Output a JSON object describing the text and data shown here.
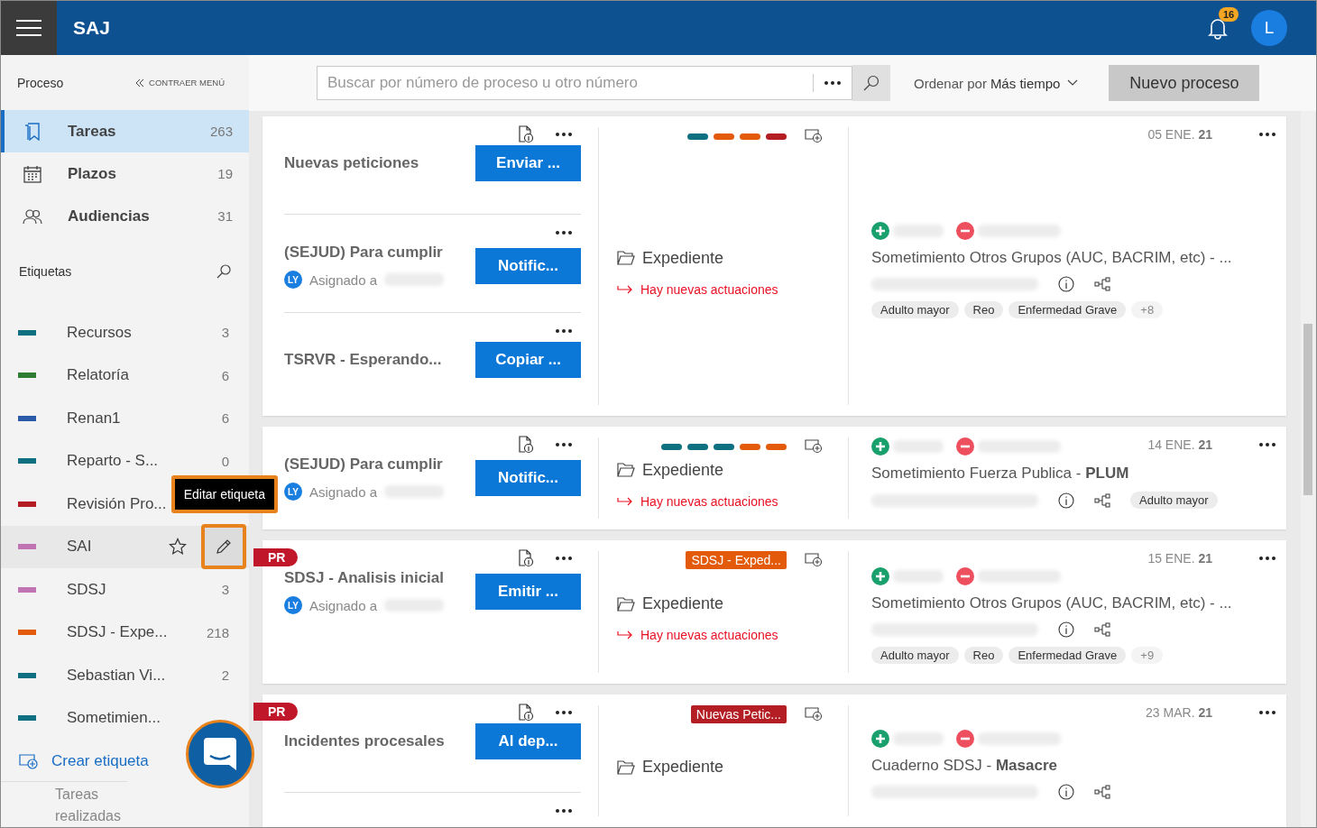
{
  "header": {
    "title": "SAJ",
    "notifications": "16",
    "avatar": "L"
  },
  "sidebar": {
    "section": "Proceso",
    "collapse": "CONTRAER MENÚ",
    "nav": [
      {
        "label": "Tareas",
        "count": "263",
        "selected": true
      },
      {
        "label": "Plazos",
        "count": "19",
        "selected": false
      },
      {
        "label": "Audiencias",
        "count": "31",
        "selected": false
      }
    ],
    "labels_title": "Etiquetas",
    "labels": [
      {
        "name": "Recursos",
        "count": "3",
        "color": "#0e7080",
        "hovered": false
      },
      {
        "name": "Relatoría",
        "count": "6",
        "color": "#2e7d32",
        "hovered": false
      },
      {
        "name": "Renan1",
        "count": "6",
        "color": "#2a5aa8",
        "hovered": false
      },
      {
        "name": "Reparto - S...",
        "count": "0",
        "color": "#0e7080",
        "hovered": false
      },
      {
        "name": "Revisión Pro...",
        "color": "#b41d23",
        "hovered": false
      },
      {
        "name": "SAI",
        "color": "#c074b4",
        "hovered": true
      },
      {
        "name": "SDSJ",
        "count": "3",
        "color": "#c074b4",
        "hovered": false
      },
      {
        "name": "SDSJ - Expe...",
        "count": "218",
        "color": "#e35a0b",
        "hovered": false
      },
      {
        "name": "Sebastian Vi...",
        "count": "2",
        "color": "#0e7080",
        "hovered": false
      },
      {
        "name": "Sometimien...",
        "color": "#0e7080",
        "hovered": false
      }
    ],
    "tooltip": "Editar etiqueta",
    "create": "Crear etiqueta",
    "done": "Tareas realizadas"
  },
  "toolbar": {
    "placeholder": "Buscar por número de proceso u otro número",
    "sort_label": "Ordenar por",
    "sort_value": "Más tiempo",
    "new_button": "Nuevo proceso"
  },
  "cards": [
    {
      "tasks": [
        {
          "title": "Nuevas peticiones",
          "button": "Enviar ...",
          "doc": true
        },
        {
          "title": "(SEJUD) Para cumplir",
          "button": "Notific...",
          "doc": false,
          "assigned": {
            "initials": "LY",
            "text": "Asignado a"
          }
        },
        {
          "title": "TSRVR - Esperando...",
          "button": "Copiar ...",
          "doc": false
        }
      ],
      "middle": {
        "markers": [
          {
            "color": "#0e7080"
          },
          {
            "color": "#e35a0b"
          },
          {
            "color": "#e35a0b"
          },
          {
            "color": "#b41d23"
          }
        ],
        "folder": "Expediente",
        "news": "Hay nuevas actuaciones"
      },
      "right": {
        "date": "05 ENE.",
        "year": "21",
        "title": "Sometimiento Otros Grupos (AUC, BACRIM, etc) - ...",
        "chips": [
          "Adulto mayor",
          "Reo",
          "Enfermedad Grave"
        ],
        "more": "+8",
        "chips_inline": false
      }
    },
    {
      "tasks": [
        {
          "title": "(SEJUD) Para cumplir",
          "button": "Notific...",
          "doc": true,
          "assigned": {
            "initials": "LY",
            "text": "Asignado a"
          }
        }
      ],
      "middle": {
        "markers": [
          {
            "color": "#0e7080"
          },
          {
            "color": "#0e7080"
          },
          {
            "color": "#0e7080"
          },
          {
            "color": "#e35a0b"
          },
          {
            "color": "#e35a0b"
          }
        ],
        "folder": "Expediente",
        "news": "Hay nuevas actuaciones"
      },
      "right": {
        "date": "14 ENE.",
        "year": "21",
        "title": "Sometimiento Fuerza Publica - **PLUM**",
        "chips": [
          "Adulto mayor"
        ],
        "chips_inline": true
      }
    },
    {
      "badge": "PR",
      "tasks": [
        {
          "title": "SDSJ - Analisis inicial",
          "button": "Emitir ...",
          "doc": true,
          "assigned": {
            "initials": "LY",
            "text": "Asignado a"
          }
        }
      ],
      "middle": {
        "label": {
          "text": "SDSJ - Exped...",
          "color": "#e35a0b"
        },
        "folder": "Expediente",
        "news": "Hay nuevas actuaciones"
      },
      "right": {
        "date": "15 ENE.",
        "year": "21",
        "title": "Sometimiento Otros Grupos (AUC, BACRIM, etc) - ...",
        "chips": [
          "Adulto mayor",
          "Reo",
          "Enfermedad Grave"
        ],
        "more": "+9",
        "chips_inline": false
      }
    },
    {
      "badge": "PR",
      "tasks": [
        {
          "title": "Incidentes procesales",
          "button": "Al dep...",
          "doc": true
        },
        {
          "doc": false
        }
      ],
      "middle": {
        "label": {
          "text": "Nuevas Petic...",
          "color": "#b41d23"
        },
        "folder": "Expediente"
      },
      "right": {
        "date": "23 MAR.",
        "year": "21",
        "title": "Cuaderno SDSJ - **Masacre**",
        "chips_inline": false
      }
    }
  ]
}
